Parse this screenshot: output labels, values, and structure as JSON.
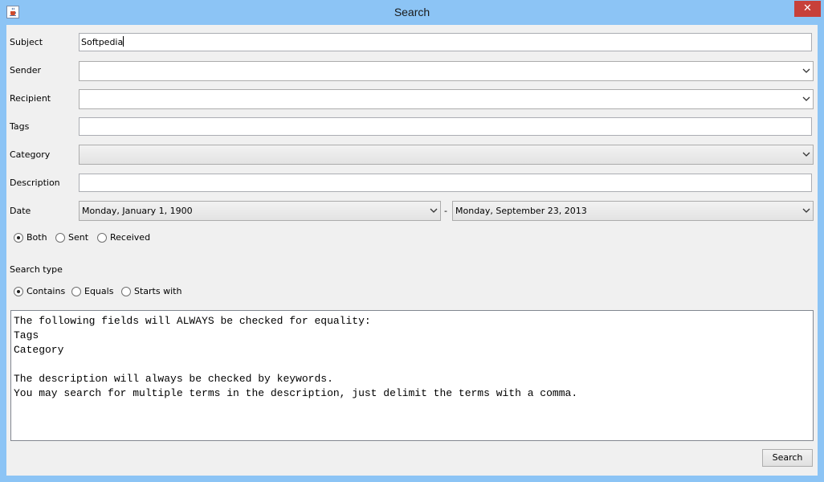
{
  "window": {
    "title": "Search",
    "close_glyph": "✕"
  },
  "labels": {
    "subject": "Subject",
    "sender": "Sender",
    "recipient": "Recipient",
    "tags": "Tags",
    "category": "Category",
    "description": "Description",
    "date": "Date",
    "date_separator": "-",
    "search_type": "Search type"
  },
  "fields": {
    "subject": "Softpedia",
    "sender": "",
    "recipient": "",
    "tags": "",
    "category": "",
    "description": "",
    "date_from": "Monday, January 1, 1900",
    "date_to": "Monday, September 23, 2013"
  },
  "direction": {
    "options": [
      "Both",
      "Sent",
      "Received"
    ],
    "selected": "Both"
  },
  "search_type": {
    "options": [
      "Contains",
      "Equals",
      "Starts with"
    ],
    "selected": "Contains"
  },
  "info_lines": [
    "The following fields will ALWAYS be checked for equality:",
    "Tags",
    "Category",
    "",
    "The description will always be checked by keywords.",
    "You may search for multiple terms in the description, just delimit the terms with a comma."
  ],
  "buttons": {
    "search": "Search"
  },
  "icons": {
    "app": "java-cup-icon",
    "close": "close-icon",
    "dropdown": "chevron-down-icon"
  }
}
